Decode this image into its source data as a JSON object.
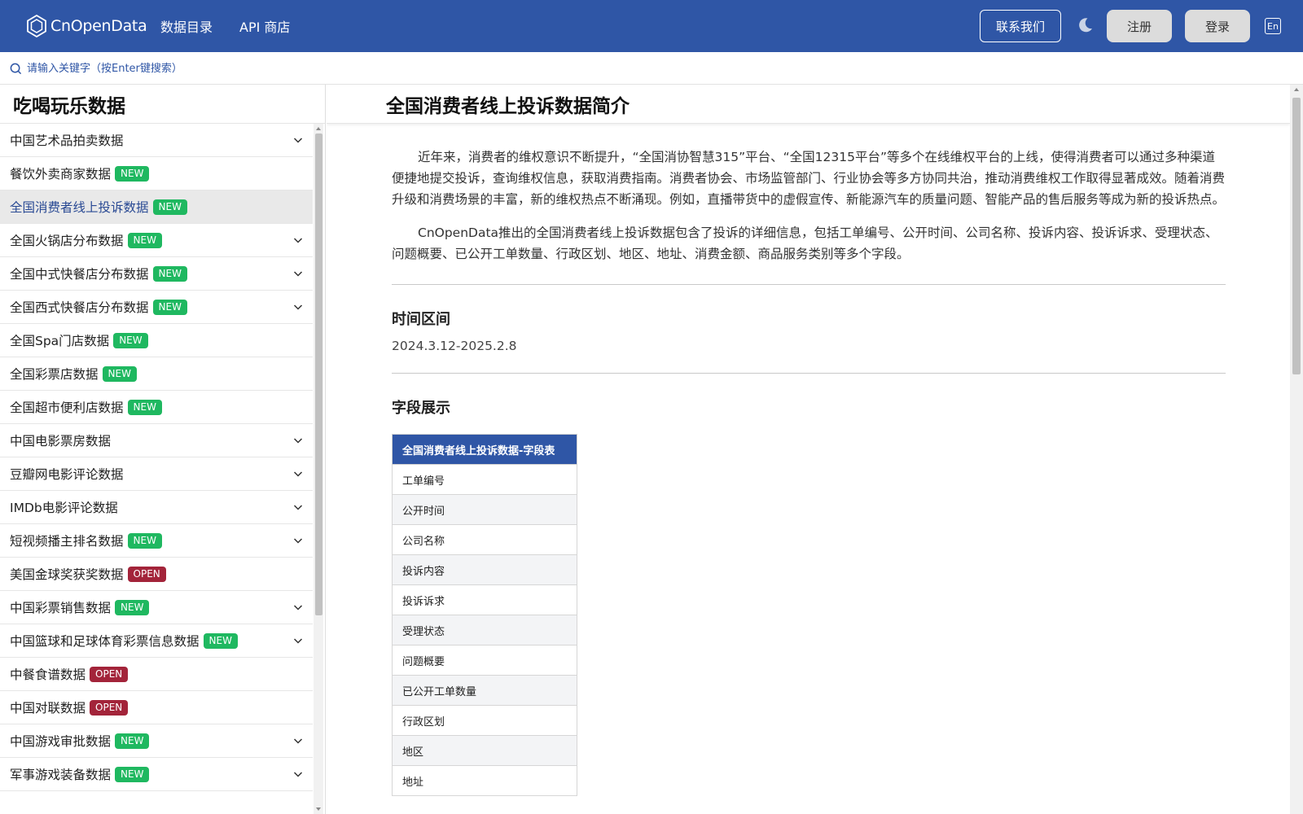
{
  "header": {
    "logo_text": "CnOpenData",
    "nav": [
      "数据目录",
      "API 商店"
    ],
    "contact_label": "联系我们",
    "register_label": "注册",
    "login_label": "登录",
    "lang_label": "En",
    "colors": {
      "primary": "#2f56a6",
      "new_badge": "#1fb860",
      "open_badge": "#a3243a"
    }
  },
  "search": {
    "placeholder": "请输入关键字（按Enter键搜索）"
  },
  "sidebar": {
    "title": "吃喝玩乐数据",
    "items": [
      {
        "label": "中国艺术品拍卖数据",
        "badge": "",
        "expandable": true,
        "active": false
      },
      {
        "label": "餐饮外卖商家数据",
        "badge": "NEW",
        "expandable": false,
        "active": false
      },
      {
        "label": "全国消费者线上投诉数据",
        "badge": "NEW",
        "expandable": false,
        "active": true
      },
      {
        "label": "全国火锅店分布数据",
        "badge": "NEW",
        "expandable": true,
        "active": false
      },
      {
        "label": "全国中式快餐店分布数据",
        "badge": "NEW",
        "expandable": true,
        "active": false
      },
      {
        "label": "全国西式快餐店分布数据",
        "badge": "NEW",
        "expandable": true,
        "active": false
      },
      {
        "label": "全国Spa门店数据",
        "badge": "NEW",
        "expandable": false,
        "active": false
      },
      {
        "label": "全国彩票店数据",
        "badge": "NEW",
        "expandable": false,
        "active": false
      },
      {
        "label": "全国超市便利店数据",
        "badge": "NEW",
        "expandable": false,
        "active": false
      },
      {
        "label": "中国电影票房数据",
        "badge": "",
        "expandable": true,
        "active": false
      },
      {
        "label": "豆瓣网电影评论数据",
        "badge": "",
        "expandable": true,
        "active": false
      },
      {
        "label": "IMDb电影评论数据",
        "badge": "",
        "expandable": true,
        "active": false
      },
      {
        "label": "短视频播主排名数据",
        "badge": "NEW",
        "expandable": true,
        "active": false
      },
      {
        "label": "美国金球奖获奖数据",
        "badge": "OPEN",
        "expandable": false,
        "active": false
      },
      {
        "label": "中国彩票销售数据",
        "badge": "NEW",
        "expandable": true,
        "active": false
      },
      {
        "label": "中国篮球和足球体育彩票信息数据",
        "badge": "NEW",
        "expandable": true,
        "active": false
      },
      {
        "label": "中餐食谱数据",
        "badge": "OPEN",
        "expandable": false,
        "active": false
      },
      {
        "label": "中国对联数据",
        "badge": "OPEN",
        "expandable": false,
        "active": false
      },
      {
        "label": "中国游戏审批数据",
        "badge": "NEW",
        "expandable": true,
        "active": false
      },
      {
        "label": "军事游戏装备数据",
        "badge": "NEW",
        "expandable": true,
        "active": false
      }
    ]
  },
  "main": {
    "title": "全国消费者线上投诉数据简介",
    "paragraphs": [
      "近年来，消费者的维权意识不断提升，“全国消协智慧315”平台、“全国12315平台”等多个在线维权平台的上线，使得消费者可以通过多种渠道便捷地提交投诉，查询维权信息，获取消费指南。消费者协会、市场监管部门、行业协会等多方协同共治，推动消费维权工作取得显著成效。随着消费升级和消费场景的丰富，新的维权热点不断涌现。例如，直播带货中的虚假宣传、新能源汽车的质量问题、智能产品的售后服务等成为新的投诉热点。",
      "CnOpenData推出的全国消费者线上投诉数据包含了投诉的详细信息，包括工单编号、公开时间、公司名称、投诉内容、投诉诉求、受理状态、问题概要、已公开工单数量、行政区划、地区、地址、消费金额、商品服务类别等多个字段。"
    ],
    "time_title": "时间区间",
    "time_value": "2024.3.12-2025.2.8",
    "fields_title": "字段展示",
    "table_header": "全国消费者线上投诉数据-字段表",
    "fields": [
      "工单编号",
      "公开时间",
      "公司名称",
      "投诉内容",
      "投诉诉求",
      "受理状态",
      "问题概要",
      "已公开工单数量",
      "行政区划",
      "地区",
      "地址"
    ]
  }
}
